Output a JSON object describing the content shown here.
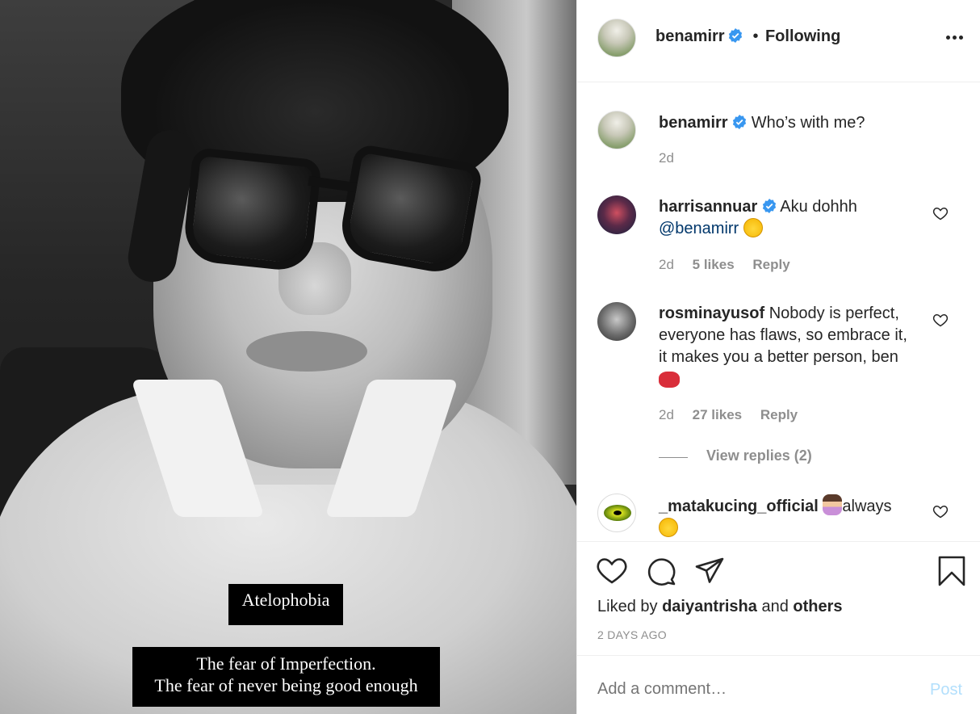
{
  "photo": {
    "caption_title": "Atelophobia",
    "caption_line1": "The fear of Imperfection.",
    "caption_line2": "The fear of never being good enough"
  },
  "header": {
    "username": "benamirr",
    "separator": "•",
    "follow_status": "Following"
  },
  "post_caption": {
    "username": "benamirr",
    "text": "Who’s with me?",
    "time": "2d"
  },
  "comments": [
    {
      "username": "harrisannuar",
      "verified": true,
      "text": "Aku dohhh",
      "mention": "@benamirr",
      "time": "2d",
      "likes": "5 likes",
      "reply_label": "Reply"
    },
    {
      "username": "rosminayusof",
      "verified": false,
      "line1": "Nobody is perfect,",
      "line2": "everyone has flaws, so embrace it,",
      "line3": "it makes you a better person, ben",
      "time": "2d",
      "likes": "27 likes",
      "reply_label": "Reply",
      "view_replies": "View replies (2)"
    },
    {
      "username": "_matakucing_official",
      "verified": false,
      "text": "always"
    }
  ],
  "actions": {
    "liked_prefix": "Liked by",
    "liked_user": "daiyantrisha",
    "liked_and": "and",
    "liked_others": "others",
    "time_ago": "2 DAYS AGO"
  },
  "comment_box": {
    "placeholder": "Add a comment…",
    "post_label": "Post"
  },
  "colors": {
    "verified_blue": "#3897f0",
    "muted_gray": "#8e8e8e",
    "post_disabled": "#b2dffc"
  }
}
